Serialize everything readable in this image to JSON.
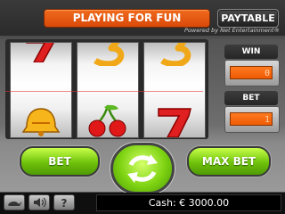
{
  "header": {
    "status_text": "PLAYING FOR FUN",
    "paytable_label": "PAYTABLE",
    "powered_by": "Powered by Net Entertainment®"
  },
  "reels": [
    {
      "top": "7",
      "bottom": "bell"
    },
    {
      "top": "3",
      "bottom": "cherries"
    },
    {
      "top": "3",
      "bottom": "7"
    }
  ],
  "meters": {
    "win_label": "WIN",
    "win_value": "0",
    "bet_label": "BET",
    "bet_value": "1"
  },
  "controls": {
    "bet_label": "BET",
    "max_bet_label": "MAX BET"
  },
  "footer": {
    "cash_text": "Cash: € 3000.00"
  },
  "colors": {
    "status_orange": "#e85a10",
    "button_green": "#7ed312",
    "lcd_orange": "#f06010"
  }
}
